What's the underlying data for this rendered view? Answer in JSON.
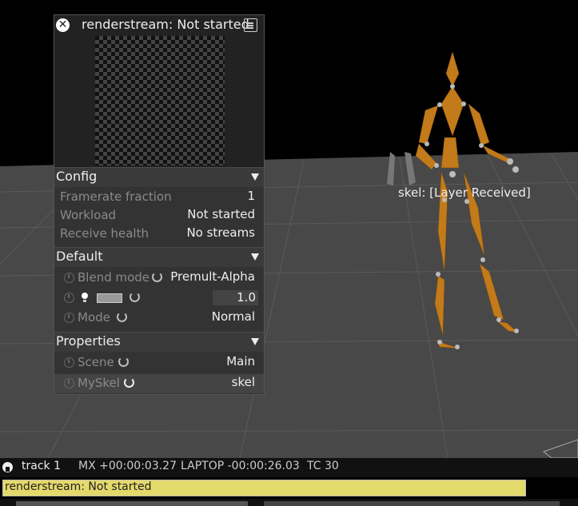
{
  "window": {
    "title": "renderstream: Not started"
  },
  "config": {
    "header": "Config",
    "rows": [
      {
        "label": "Framerate fraction",
        "value": "1"
      },
      {
        "label": "Workload",
        "value": "Not started"
      },
      {
        "label": "Receive health",
        "value": "No streams"
      }
    ]
  },
  "default_section": {
    "header": "Default",
    "blend_mode_label": "Blend mode",
    "blend_mode_value": "Premult-Alpha",
    "brightness_value": "1.0",
    "mode_label": "Mode",
    "mode_value": "Normal"
  },
  "properties": {
    "header": "Properties",
    "scene_label": "Scene",
    "scene_value": "Main",
    "myskel_label": "MySkel",
    "myskel_value": "skel"
  },
  "viewport": {
    "skeleton_label": "skel: [Layer Received]"
  },
  "status_bar": {
    "track": "track 1",
    "mx": "MX +00:00:03.27",
    "laptop": "LAPTOP -00:00:26.03",
    "tc": "TC 30"
  },
  "notification": "renderstream: Not started",
  "colors": {
    "skeleton": "#c27a1a",
    "notification_bg": "#e4d96b",
    "panel_bg": "#333333"
  }
}
